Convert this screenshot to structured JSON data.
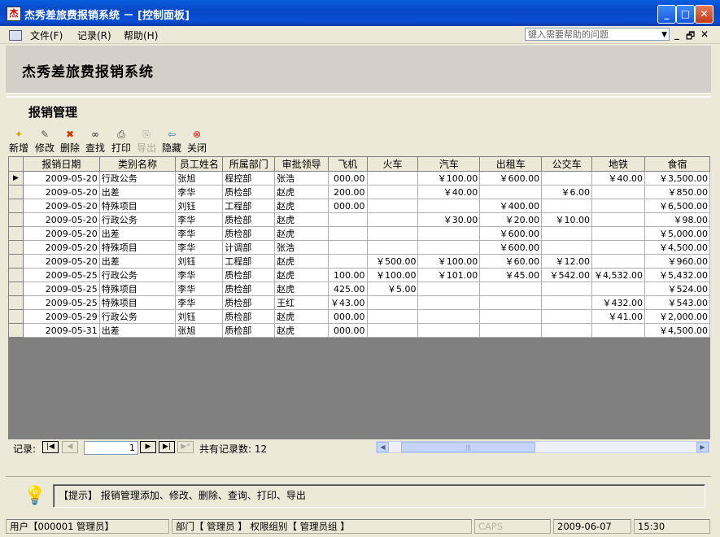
{
  "window": {
    "title": "杰秀差旅费报销系统 － [控制面板]",
    "app_icon_glyph": "杰",
    "controls": {
      "minimize": "_",
      "maximize": "□",
      "close": "✕"
    }
  },
  "menubar": {
    "items": [
      {
        "label": "文件(F)"
      },
      {
        "label": "记录(R)"
      },
      {
        "label": "帮助(H)"
      }
    ],
    "help_placeholder": "键入需要帮助的问题",
    "help_dropdown_glyph": "▼",
    "mdi": {
      "min": "_",
      "restore": "🗗",
      "close": "✕"
    }
  },
  "header": {
    "title": "杰秀差旅费报销系统"
  },
  "section": {
    "title": "报销管理"
  },
  "toolbar": {
    "tools": [
      {
        "label": "新增",
        "icon": "new-icon",
        "glyph": "✦",
        "color": "#c9a800"
      },
      {
        "label": "修改",
        "icon": "edit-icon",
        "glyph": "✎",
        "color": "#555"
      },
      {
        "label": "删除",
        "icon": "delete-icon",
        "glyph": "✖",
        "color": "#cc3300"
      },
      {
        "label": "查找",
        "icon": "binoculars-icon",
        "glyph": "∞",
        "color": "#222"
      },
      {
        "label": "打印",
        "icon": "printer-icon",
        "glyph": "⎙",
        "color": "#333"
      },
      {
        "label": "导出",
        "icon": "export-icon",
        "glyph": "⎘",
        "color": "#aca899",
        "disabled": true
      },
      {
        "label": "隐藏",
        "icon": "hide-arrow-icon",
        "glyph": "⇦",
        "color": "#1a7ab8"
      },
      {
        "label": "关闭",
        "icon": "close-circle-icon",
        "glyph": "⊗",
        "color": "#e01010"
      }
    ]
  },
  "grid": {
    "columns": [
      "报销日期",
      "类别名称",
      "员工姓名",
      "所属部门",
      "审批领导",
      "飞机",
      "火车",
      "汽车",
      "出租车",
      "公交车",
      "地铁",
      "食宿"
    ],
    "current_row_glyph": "▶",
    "rows": [
      [
        "2009-05-20",
        "行政公务",
        "张旭",
        "程控部",
        "张浩",
        "000.00",
        "",
        "￥100.00",
        "￥600.00",
        "",
        "￥40.00",
        "￥3,500.00"
      ],
      [
        "2009-05-20",
        "出差",
        "李华",
        "质检部",
        "赵虎",
        "200.00",
        "",
        "￥40.00",
        "",
        "￥6.00",
        "",
        "￥850.00"
      ],
      [
        "2009-05-20",
        "特殊项目",
        "刘钰",
        "工程部",
        "赵虎",
        "000.00",
        "",
        "",
        "￥400.00",
        "",
        "",
        "￥6,500.00"
      ],
      [
        "2009-05-20",
        "行政公务",
        "李华",
        "质检部",
        "赵虎",
        "",
        "",
        "￥30.00",
        "￥20.00",
        "￥10.00",
        "",
        "￥98.00"
      ],
      [
        "2009-05-20",
        "出差",
        "李华",
        "质检部",
        "赵虎",
        "",
        "",
        "",
        "￥600.00",
        "",
        "",
        "￥5,000.00"
      ],
      [
        "2009-05-20",
        "特殊项目",
        "李华",
        "计调部",
        "张浩",
        "",
        "",
        "",
        "￥600.00",
        "",
        "",
        "￥4,500.00"
      ],
      [
        "2009-05-20",
        "出差",
        "刘钰",
        "工程部",
        "赵虎",
        "",
        "￥500.00",
        "￥100.00",
        "￥60.00",
        "￥12.00",
        "",
        "￥960.00"
      ],
      [
        "2009-05-25",
        "行政公务",
        "李华",
        "质检部",
        "赵虎",
        "100.00",
        "￥100.00",
        "￥101.00",
        "￥45.00",
        "￥542.00",
        "￥4,532.00",
        "￥5,432.00"
      ],
      [
        "2009-05-25",
        "特殊项目",
        "李华",
        "质检部",
        "赵虎",
        "425.00",
        "￥5.00",
        "",
        "",
        "",
        "",
        "￥524.00"
      ],
      [
        "2009-05-25",
        "特殊项目",
        "李华",
        "质检部",
        "王红",
        "￥43.00",
        "",
        "",
        "",
        "",
        "￥432.00",
        "￥543.00"
      ],
      [
        "2009-05-29",
        "行政公务",
        "刘钰",
        "质检部",
        "赵虎",
        "000.00",
        "",
        "",
        "",
        "",
        "￥41.00",
        "￥2,000.00"
      ],
      [
        "2009-05-31",
        "出差",
        "张旭",
        "质检部",
        "赵虎",
        "000.00",
        "",
        "",
        "",
        "",
        "",
        "￥4,500.00"
      ]
    ]
  },
  "navigator": {
    "label": "记录:",
    "first": "|◀",
    "prev": "◀",
    "current": "1",
    "next": "▶",
    "last": "▶|",
    "new": "▶*",
    "total_text": "共有记录数: 12"
  },
  "scrollbar": {
    "left": "◀",
    "right": "▶",
    "thumb": "|||"
  },
  "tip": {
    "bulb_glyph": "💡",
    "text": "【提示】 报销管理添加、修改、删除、查询、打印、导出"
  },
  "status": {
    "user": "用户【000001 管理员】",
    "dept": "部门【 管理员 】 权限组别【 管理员组 】",
    "caps": "CAPS",
    "date": "2009-06-07",
    "time": "15:30"
  }
}
